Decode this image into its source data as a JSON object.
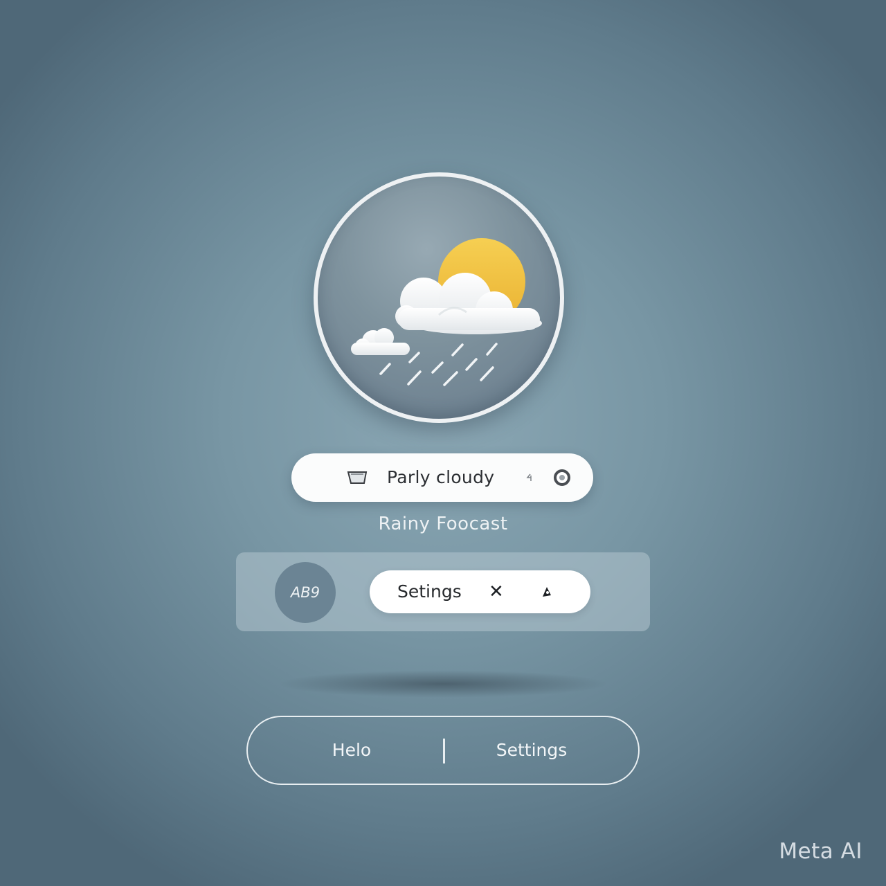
{
  "weather": {
    "icon": "partly-cloudy-rain-icon",
    "sun_color": "#f2c23e",
    "cloud_color": "#f5f6f7"
  },
  "status": {
    "text": "Parly cloudy",
    "left_icon": "window-icon",
    "mid_icon": "small-glyph-icon",
    "right_icon": "radio-dot-icon"
  },
  "subtitle": "Rainy Foocast",
  "panel": {
    "avatar_text": "AB9",
    "settings_label": "Setings",
    "close_icon": "close-icon",
    "bell_icon": "bell-icon"
  },
  "bottom_bar": {
    "help_label": "Helo",
    "settings_label": "Settings"
  },
  "watermark": "Meta AI",
  "colors": {
    "background": "#7896a4",
    "pill": "#fbfcfc",
    "accent_sun": "#f2c23e"
  }
}
